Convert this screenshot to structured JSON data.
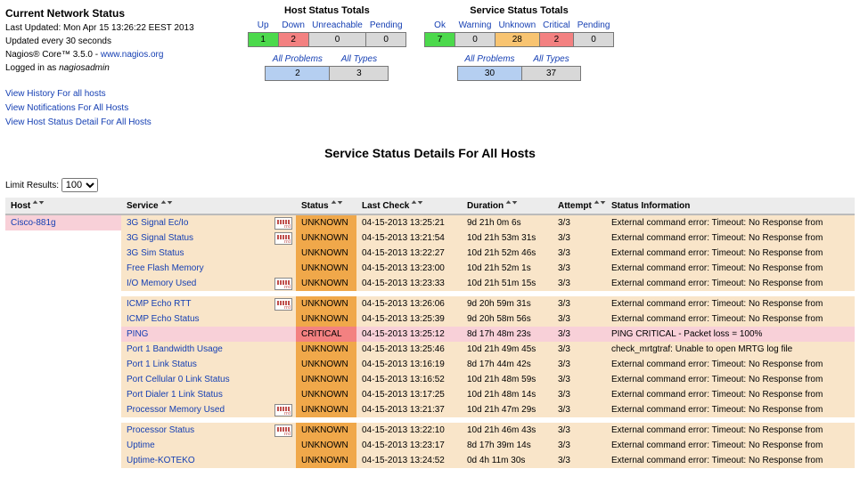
{
  "status_block": {
    "title": "Current Network Status",
    "updated": "Last Updated: Mon Apr 15 13:26:22 EEST 2013",
    "interval": "Updated every 30 seconds",
    "product_prefix": "Nagios® Core™ 3.5.0 - ",
    "product_link": "www.nagios.org",
    "logged_in_prefix": "Logged in as ",
    "logged_in_user": "nagiosadmin",
    "links": [
      "View History For all hosts",
      "View Notifications For All Hosts",
      "View Host Status Detail For All Hosts"
    ]
  },
  "host_totals": {
    "title": "Host Status Totals",
    "headers": [
      "Up",
      "Down",
      "Unreachable",
      "Pending"
    ],
    "values": [
      "1",
      "2",
      "0",
      "0"
    ],
    "classes": [
      "c-up",
      "c-down",
      "c-gray",
      "c-gray"
    ],
    "row2_headers": [
      "All Problems",
      "All Types"
    ],
    "row2_values": [
      "2",
      "3"
    ],
    "row2_classes": [
      "c-blue",
      "c-gray"
    ]
  },
  "service_totals": {
    "title": "Service Status Totals",
    "headers": [
      "Ok",
      "Warning",
      "Unknown",
      "Critical",
      "Pending"
    ],
    "values": [
      "7",
      "0",
      "28",
      "2",
      "0"
    ],
    "classes": [
      "c-ok",
      "c-gray",
      "c-unk",
      "c-crit",
      "c-gray"
    ],
    "row2_headers": [
      "All Problems",
      "All Types"
    ],
    "row2_values": [
      "30",
      "37"
    ],
    "row2_classes": [
      "c-blue",
      "c-gray"
    ]
  },
  "page_header": "Service Status Details For All Hosts",
  "limit_label": "Limit Results:",
  "limit_value": "100",
  "columns": {
    "host": "Host",
    "service": "Service",
    "status": "Status",
    "last_check": "Last Check",
    "duration": "Duration",
    "attempt": "Attempt",
    "info": "Status Information"
  },
  "host_name": "Cisco-881g",
  "rows": [
    {
      "service": "3G Signal Ec/Io",
      "status": "UNKNOWN",
      "rrd": true,
      "last_check": "04-15-2013 13:25:21",
      "duration": "9d 21h 0m 6s",
      "attempt": "3/3",
      "info": "External command error: Timeout: No Response from",
      "blank_before": false
    },
    {
      "service": "3G Signal Status",
      "status": "UNKNOWN",
      "rrd": true,
      "last_check": "04-15-2013 13:21:54",
      "duration": "10d 21h 53m 31s",
      "attempt": "3/3",
      "info": "External command error: Timeout: No Response from",
      "blank_before": false
    },
    {
      "service": "3G Sim Status",
      "status": "UNKNOWN",
      "rrd": false,
      "last_check": "04-15-2013 13:22:27",
      "duration": "10d 21h 52m 46s",
      "attempt": "3/3",
      "info": "External command error: Timeout: No Response from",
      "blank_before": false
    },
    {
      "service": "Free Flash Memory",
      "status": "UNKNOWN",
      "rrd": false,
      "last_check": "04-15-2013 13:23:00",
      "duration": "10d 21h 52m 1s",
      "attempt": "3/3",
      "info": "External command error: Timeout: No Response from",
      "blank_before": false
    },
    {
      "service": "I/O Memory Used",
      "status": "UNKNOWN",
      "rrd": true,
      "last_check": "04-15-2013 13:23:33",
      "duration": "10d 21h 51m 15s",
      "attempt": "3/3",
      "info": "External command error: Timeout: No Response from",
      "blank_before": false
    },
    {
      "service": "ICMP Echo RTT",
      "status": "UNKNOWN",
      "rrd": true,
      "last_check": "04-15-2013 13:26:06",
      "duration": "9d 20h 59m 31s",
      "attempt": "3/3",
      "info": "External command error: Timeout: No Response from",
      "blank_before": true
    },
    {
      "service": "ICMP Echo Status",
      "status": "UNKNOWN",
      "rrd": false,
      "last_check": "04-15-2013 13:25:39",
      "duration": "9d 20h 58m 56s",
      "attempt": "3/3",
      "info": "External command error: Timeout: No Response from",
      "blank_before": false
    },
    {
      "service": "PING",
      "status": "CRITICAL",
      "rrd": false,
      "last_check": "04-15-2013 13:25:12",
      "duration": "8d 17h 48m 23s",
      "attempt": "3/3",
      "info": "PING CRITICAL - Packet loss = 100%",
      "blank_before": false
    },
    {
      "service": "Port 1 Bandwidth Usage",
      "status": "UNKNOWN",
      "rrd": false,
      "last_check": "04-15-2013 13:25:46",
      "duration": "10d 21h 49m 45s",
      "attempt": "3/3",
      "info": "check_mrtgtraf: Unable to open MRTG log file",
      "blank_before": false
    },
    {
      "service": "Port 1 Link Status",
      "status": "UNKNOWN",
      "rrd": false,
      "last_check": "04-15-2013 13:16:19",
      "duration": "8d 17h 44m 42s",
      "attempt": "3/3",
      "info": "External command error: Timeout: No Response from",
      "blank_before": false
    },
    {
      "service": "Port Cellular 0 Link Status",
      "status": "UNKNOWN",
      "rrd": false,
      "last_check": "04-15-2013 13:16:52",
      "duration": "10d 21h 48m 59s",
      "attempt": "3/3",
      "info": "External command error: Timeout: No Response from",
      "blank_before": false
    },
    {
      "service": "Port Dialer 1 Link Status",
      "status": "UNKNOWN",
      "rrd": false,
      "last_check": "04-15-2013 13:17:25",
      "duration": "10d 21h 48m 14s",
      "attempt": "3/3",
      "info": "External command error: Timeout: No Response from",
      "blank_before": false
    },
    {
      "service": "Processor Memory Used",
      "status": "UNKNOWN",
      "rrd": true,
      "last_check": "04-15-2013 13:21:37",
      "duration": "10d 21h 47m 29s",
      "attempt": "3/3",
      "info": "External command error: Timeout: No Response from",
      "blank_before": false
    },
    {
      "service": "Processor Status",
      "status": "UNKNOWN",
      "rrd": true,
      "last_check": "04-15-2013 13:22:10",
      "duration": "10d 21h 46m 43s",
      "attempt": "3/3",
      "info": "External command error: Timeout: No Response from",
      "blank_before": true
    },
    {
      "service": "Uptime",
      "status": "UNKNOWN",
      "rrd": false,
      "last_check": "04-15-2013 13:23:17",
      "duration": "8d 17h 39m 14s",
      "attempt": "3/3",
      "info": "External command error: Timeout: No Response from",
      "blank_before": false
    },
    {
      "service": "Uptime-KOTEKO",
      "status": "UNKNOWN",
      "rrd": false,
      "last_check": "04-15-2013 13:24:52",
      "duration": "0d 4h 11m 30s",
      "attempt": "3/3",
      "info": "External command error: Timeout: No Response from",
      "blank_before": false
    }
  ]
}
